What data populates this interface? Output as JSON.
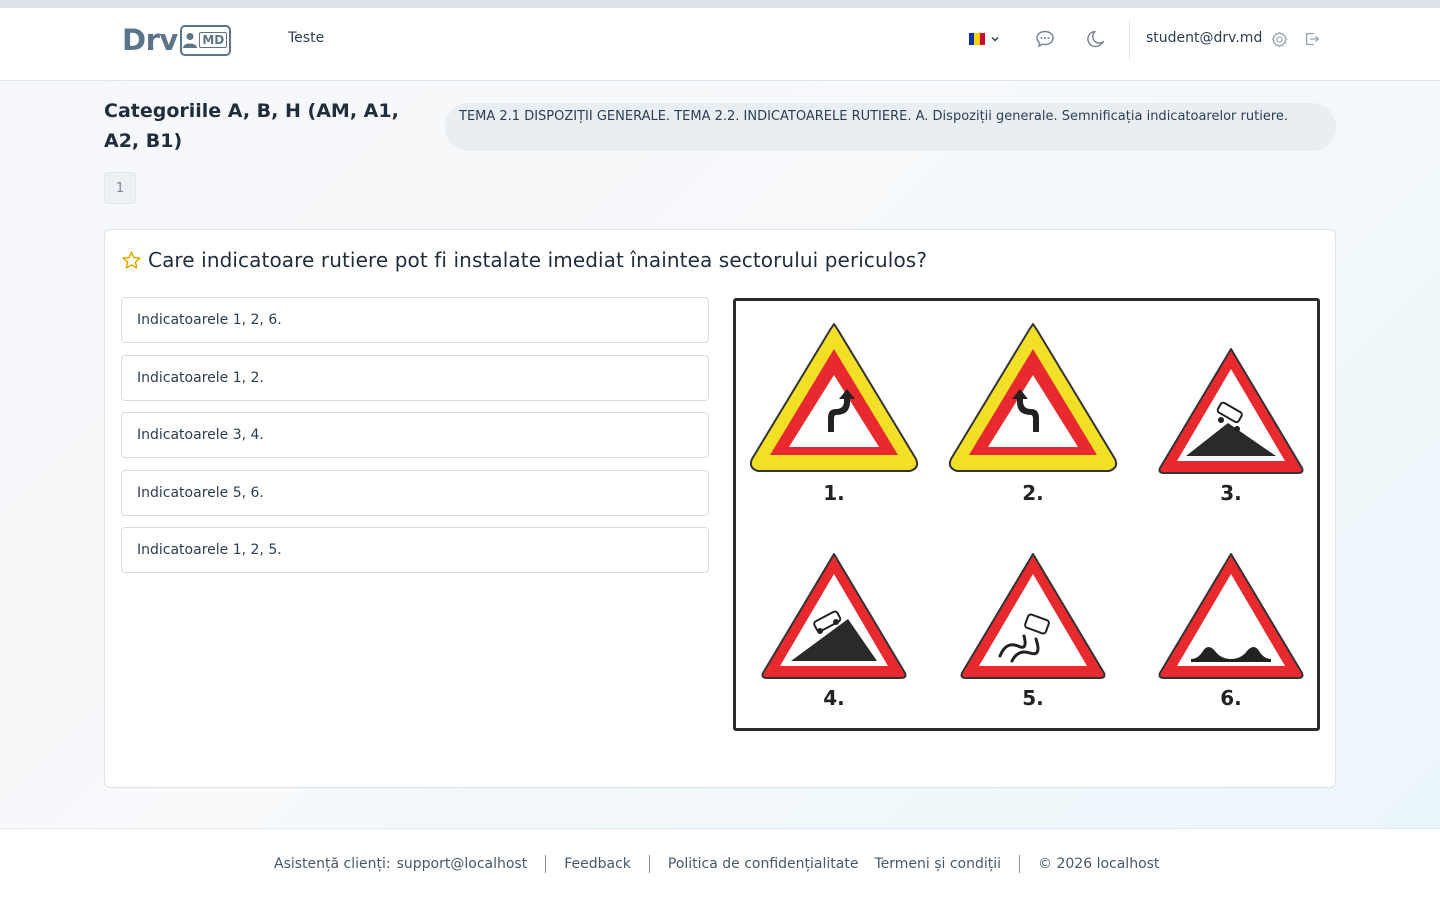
{
  "nav": {
    "logo_text": "Drv",
    "logo_badge": "MD",
    "link_tests": "Teste",
    "user_email": "student@drv.md",
    "flag_colors": [
      "#0033a0",
      "#ffd200",
      "#cc092f"
    ]
  },
  "page": {
    "title": "Categoriile A, B, H (AM, A1, A2, B1)",
    "theme": "TEMA 2.1 DISPOZIȚII GENERALE. TEMA 2.2. INDICATOARELE RUTIERE. A. Dispoziții generale. Semnificația indicatoarelor rutiere.",
    "page_number": "1"
  },
  "question": {
    "text": "Care indicatoare rutiere pot fi instalate imediat înaintea sectorului periculos?",
    "answers": [
      "Indicatoarele 1, 2, 6.",
      "Indicatoarele 1, 2.",
      "Indicatoarele 3, 4.",
      "Indicatoarele 5, 6.",
      "Indicatoarele 1, 2, 5."
    ],
    "signs": [
      {
        "label": "1.",
        "kind": "double-bend-right-first",
        "border": "yellow"
      },
      {
        "label": "2.",
        "kind": "double-bend-left-first",
        "border": "yellow"
      },
      {
        "label": "3.",
        "kind": "steep-descent",
        "border": "white"
      },
      {
        "label": "4.",
        "kind": "steep-ascent",
        "border": "white"
      },
      {
        "label": "5.",
        "kind": "slippery-road",
        "border": "white"
      },
      {
        "label": "6.",
        "kind": "uneven-road",
        "border": "white"
      }
    ]
  },
  "footer": {
    "support_label": "Asistență clienți:",
    "support_email": "support@localhost",
    "feedback": "Feedback",
    "privacy": "Politica de confidențialitate",
    "terms": "Termeni și condiții",
    "copyright": "© 2026 localhost"
  },
  "colors": {
    "sign_red": "#e8292e",
    "sign_yellow": "#f2e027",
    "star": "#e0a800",
    "logo": "#5b7489"
  }
}
